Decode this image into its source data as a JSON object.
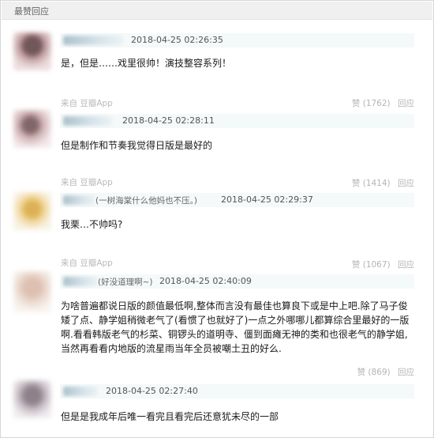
{
  "section": {
    "title": "最赞回应"
  },
  "comments": [
    {
      "timestamp": "2018-04-25 02:26:35",
      "text": "是，但是……戏里很帅！演技整容系列！",
      "likes": "赞 (1762)",
      "reply": "回应",
      "source": "来自 豆瓣App"
    },
    {
      "timestamp": "2018-04-25 02:28:11",
      "text": "但是制作和节奏我觉得日版是最好的",
      "likes": "赞 (1414)",
      "reply": "回应",
      "source": "来自 豆瓣App"
    },
    {
      "reply_to": "(一树海棠什么他妈也不压。)",
      "timestamp": "2018-04-25 02:29:37",
      "text": "我栗…不帅吗?",
      "likes": "赞 (1067)",
      "reply": "回应",
      "source": "来自 豆瓣App"
    },
    {
      "reply_to": "(好没道理啊~)",
      "timestamp": "2018-04-25 02:40:09",
      "text": "为啥普遍都说日版的颜值最低啊,整体而言没有最佳也算良下或是中上吧.除了马子俊矮了点、静学姐稍微老气了(看惯了也就好了)一点之外哪哪儿都算综合里最好的一版啊.看看韩版老气的杉菜、铜锣头的道明寺、僵到面瘫无神的类和也很老气的静学姐,当然再看看内地版的流星雨当年全员被嘲土丑的好么.",
      "likes": "赞 (869)",
      "reply": "回应"
    },
    {
      "timestamp": "2018-04-25 02:27:40",
      "text": "但是是我成年后唯一看完且看完后还意犹未尽的一部"
    }
  ]
}
